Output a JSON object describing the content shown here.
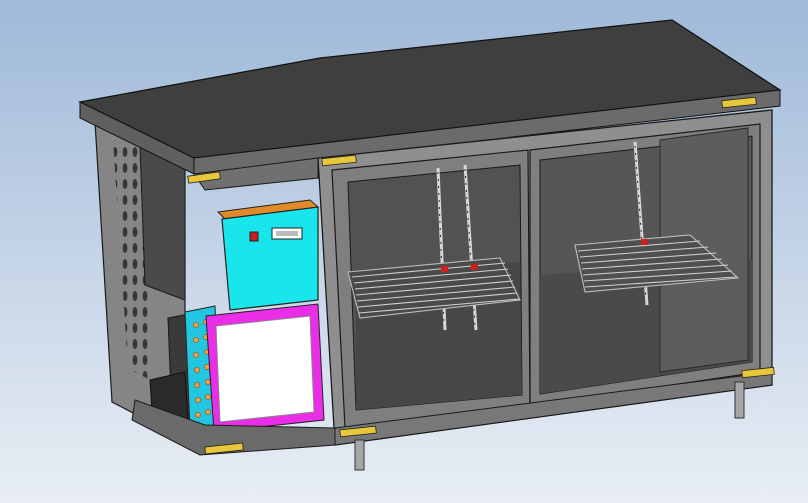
{
  "scene": {
    "subject": "",
    "colors": {
      "bg_top": "#9fb9d8",
      "bg_bottom": "#e9eef5",
      "steel": "#8c8c8c",
      "steel_dark": "#5f5f5f",
      "top": "#3f3f3f",
      "outline": "#1a1a1a",
      "cyan_box": "#19e5ec",
      "orange": "#f0a040",
      "magenta": "#ea2ee8",
      "hinge": "#e8c83a",
      "red": "#cc1f1f"
    },
    "icons": {
      "controller_switch": "power-switch-icon",
      "controller_display": "digital-display-icon",
      "hinge": "hinge-icon"
    }
  }
}
